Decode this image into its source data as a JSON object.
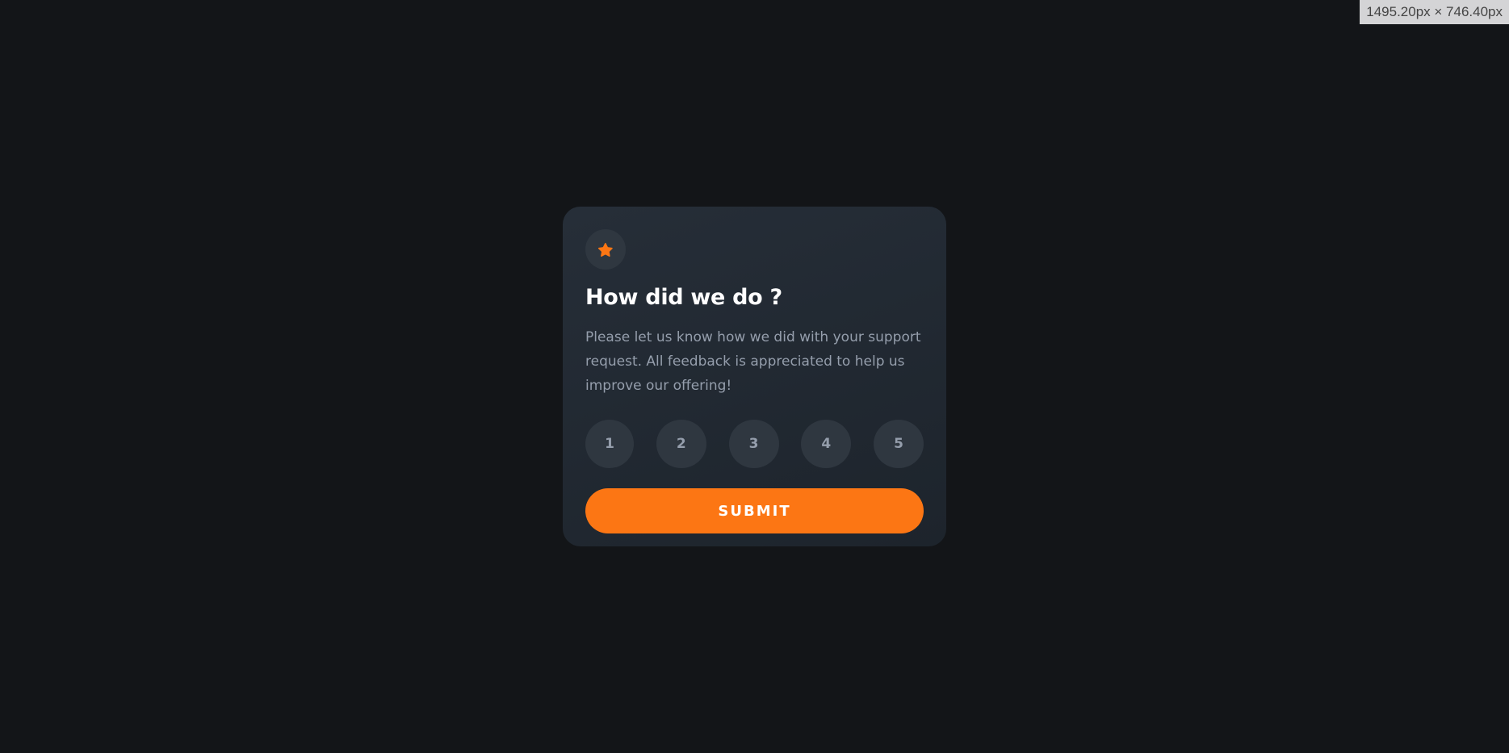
{
  "viewport_badge": "1495.20px × 746.40px",
  "card": {
    "icon": "star-icon",
    "title": "How did we do ?",
    "description": "Please let us know how we did with your support request. All feedback is appreciated to help us improve our offering!",
    "ratings": [
      "1",
      "2",
      "3",
      "4",
      "5"
    ],
    "submit_label": "SUBMIT"
  },
  "colors": {
    "background": "#131518",
    "card": "#232a33",
    "accent": "#fc7614",
    "circle": "#2f3740",
    "muted_text": "#959eac",
    "title_text": "#ffffff"
  }
}
